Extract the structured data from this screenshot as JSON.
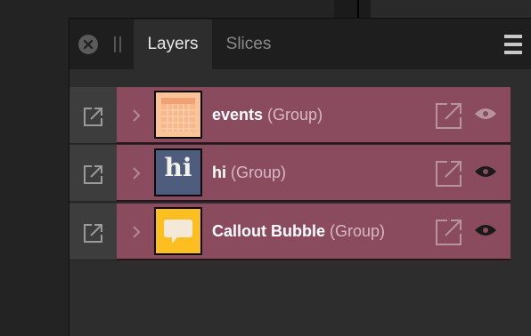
{
  "panel": {
    "tabs": [
      {
        "label": "Layers",
        "active": true
      },
      {
        "label": "Slices",
        "active": false
      }
    ]
  },
  "layers": [
    {
      "name": "events",
      "type": " (Group)",
      "thumbnail": "calendar-thumbnail",
      "visible": true
    },
    {
      "name": "hi",
      "type": " (Group)",
      "thumbnail": "hi-thumbnail",
      "thumb_text": "hi",
      "visible": true
    },
    {
      "name": "Callout Bubble",
      "type": " (Group)",
      "thumbnail": "speech-bubble-thumbnail",
      "visible": true
    }
  ],
  "colors": {
    "row_selected": "#8a4b5f",
    "panel_bg": "#2d2d2d",
    "tabbar_bg": "#1e1e1e",
    "events_thumb": "#f9c49a",
    "hi_thumb": "#4e5d7e",
    "callout_thumb": "#fdbf1f"
  }
}
